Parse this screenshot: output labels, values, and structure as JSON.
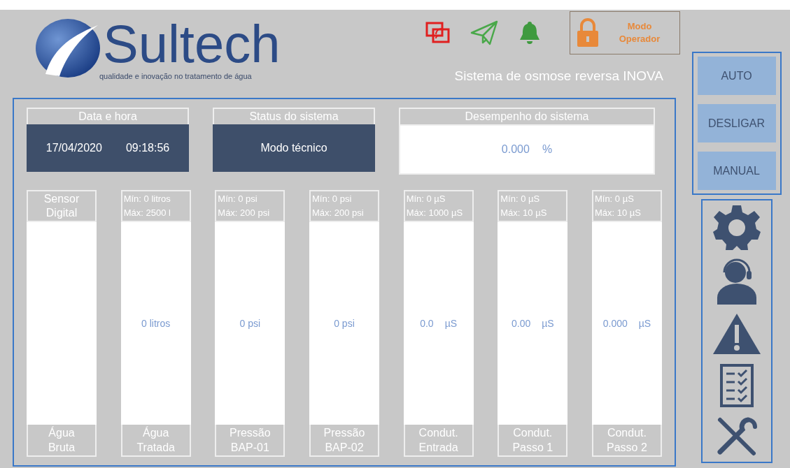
{
  "header": {
    "brand": "Sultech",
    "tagline": "qualidade e inovação no tratamento de água",
    "subtitle": "Sistema de osmose reversa INOVA"
  },
  "toolbar": {
    "lock_button": {
      "lines": [
        "Modo",
        "Operador"
      ]
    }
  },
  "cards": [
    {
      "kind": "dark",
      "title": "Data e hora",
      "texts": [
        "17/04/2020",
        "09:18:56"
      ]
    },
    {
      "kind": "dark",
      "title": "Status do sistema",
      "texts": [
        "Modo técnico"
      ]
    },
    {
      "kind": "light",
      "title": "Desempenho do sistema",
      "texts": [
        "0.000",
        "%"
      ]
    }
  ],
  "sensors": [
    {
      "header": [
        "Sensor",
        "Digital"
      ],
      "footer": [
        "Água",
        "Bruta"
      ]
    },
    {
      "header": [
        "Mín: 0 litros",
        "Máx: 2500 l"
      ],
      "value": "0 litros",
      "footer": [
        "Água",
        "Tratada"
      ]
    },
    {
      "header": [
        "Mín: 0 psi",
        "Máx: 200 psi"
      ],
      "value": "0 psi",
      "footer": [
        "Pressão",
        "BAP-01"
      ]
    },
    {
      "header": [
        "Mín: 0 psi",
        "Máx: 200 psi"
      ],
      "value": "0 psi",
      "footer": [
        "Pressão",
        "BAP-02"
      ]
    },
    {
      "header": [
        "Mín: 0 µS",
        "Máx: 1000 µS"
      ],
      "value": "0.0",
      "unit": "µS",
      "footer": [
        "Condut.",
        "Entrada"
      ]
    },
    {
      "header": [
        "Mín: 0 µS",
        "Máx: 10 µS"
      ],
      "value": "0.00",
      "unit": "µS",
      "footer": [
        "Condut.",
        "Passo 1"
      ]
    },
    {
      "header": [
        "Mín: 0 µS",
        "Máx: 10 µS"
      ],
      "value": "0.000",
      "unit": "µS",
      "footer": [
        "Condut.",
        "Passo 2"
      ]
    }
  ],
  "mode_buttons": [
    "AUTO",
    "DESLIGAR",
    "MANUAL"
  ]
}
